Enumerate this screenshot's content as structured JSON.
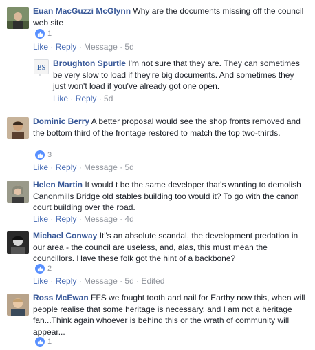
{
  "comments": [
    {
      "author": "Euan MacGuzzi McGlynn",
      "text": "Why are the documents missing off the council web site",
      "likes": "1",
      "actions": {
        "like": "Like",
        "reply": "Reply",
        "message": "Message",
        "time": "5d"
      },
      "reply": {
        "author": "Broughton Spurtle",
        "text": "I'm not sure that they are. They can sometimes be very slow to load if they're big documents. And sometimes they just won't load if you've already got one open.",
        "actions": {
          "like": "Like",
          "reply": "Reply",
          "time": "5d"
        }
      }
    },
    {
      "author": "Dominic Berry",
      "text": "A better proposal would see the shop fronts removed and the bottom third of the frontage restored to match the top two-thirds.",
      "likes": "3",
      "actions": {
        "like": "Like",
        "reply": "Reply",
        "message": "Message",
        "time": "5d"
      }
    },
    {
      "author": "Helen Martin",
      "text": "It would t be the same developer that's wanting to demolish Canonmills Bridge old stables building too would it? To go with the canon court building over the road.",
      "actions": {
        "like": "Like",
        "reply": "Reply",
        "message": "Message",
        "time": "4d"
      }
    },
    {
      "author": "Michael Conway",
      "text": "It\"s an absolute scandal, the development predation in our area - the council are useless, and, alas, this must mean the councillors. Have these folk got the hint of a backbone?",
      "likes": "2",
      "actions": {
        "like": "Like",
        "reply": "Reply",
        "message": "Message",
        "time": "5d",
        "edited": "Edited"
      }
    },
    {
      "author": "Ross McEwan",
      "text": "FFS we fought tooth and nail for Earthy now this, when will people realise that some heritage is necessary, and I am not a heritage fan...Think again whoever is behind this or the wrath of community will appear...",
      "likes": "1"
    }
  ],
  "icons": {
    "like": "thumbs-up-icon"
  },
  "colors": {
    "name": "#385898",
    "link": "#4267b2",
    "meta": "#90949c",
    "like_badge": "#5890ff"
  }
}
